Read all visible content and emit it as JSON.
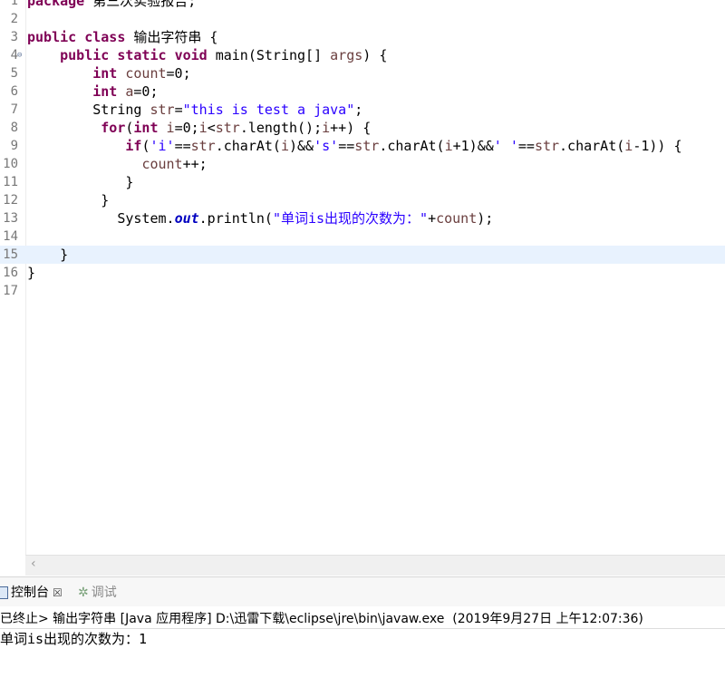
{
  "editor": {
    "lines": [
      {
        "n": "1",
        "segs": [
          {
            "t": "package",
            "c": "kw"
          },
          {
            "t": " 第三次实验报告;",
            "c": ""
          }
        ]
      },
      {
        "n": "2",
        "segs": []
      },
      {
        "n": "3",
        "segs": [
          {
            "t": "public",
            "c": "kw"
          },
          {
            "t": " ",
            "c": ""
          },
          {
            "t": "class",
            "c": "kw"
          },
          {
            "t": " 输出字符串 {",
            "c": ""
          }
        ]
      },
      {
        "n": "4",
        "fold": true,
        "segs": [
          {
            "t": "    ",
            "c": ""
          },
          {
            "t": "public",
            "c": "kw"
          },
          {
            "t": " ",
            "c": ""
          },
          {
            "t": "static",
            "c": "kw"
          },
          {
            "t": " ",
            "c": ""
          },
          {
            "t": "void",
            "c": "kw"
          },
          {
            "t": " main(String[] ",
            "c": ""
          },
          {
            "t": "args",
            "c": "var"
          },
          {
            "t": ") {",
            "c": ""
          }
        ]
      },
      {
        "n": "5",
        "segs": [
          {
            "t": "        ",
            "c": ""
          },
          {
            "t": "int",
            "c": "kw"
          },
          {
            "t": " ",
            "c": ""
          },
          {
            "t": "count",
            "c": "var"
          },
          {
            "t": "=0;",
            "c": ""
          }
        ]
      },
      {
        "n": "6",
        "segs": [
          {
            "t": "        ",
            "c": ""
          },
          {
            "t": "int",
            "c": "kw"
          },
          {
            "t": " ",
            "c": ""
          },
          {
            "t": "a",
            "c": "var"
          },
          {
            "t": "=0;",
            "c": ""
          }
        ]
      },
      {
        "n": "7",
        "segs": [
          {
            "t": "        String ",
            "c": ""
          },
          {
            "t": "str",
            "c": "var"
          },
          {
            "t": "=",
            "c": ""
          },
          {
            "t": "\"this is test a java\"",
            "c": "str"
          },
          {
            "t": ";",
            "c": ""
          }
        ]
      },
      {
        "n": "8",
        "segs": [
          {
            "t": "         ",
            "c": ""
          },
          {
            "t": "for",
            "c": "kw"
          },
          {
            "t": "(",
            "c": ""
          },
          {
            "t": "int",
            "c": "kw"
          },
          {
            "t": " ",
            "c": ""
          },
          {
            "t": "i",
            "c": "var"
          },
          {
            "t": "=0;",
            "c": ""
          },
          {
            "t": "i",
            "c": "var"
          },
          {
            "t": "<",
            "c": ""
          },
          {
            "t": "str",
            "c": "var"
          },
          {
            "t": ".length();",
            "c": ""
          },
          {
            "t": "i",
            "c": "var"
          },
          {
            "t": "++) {",
            "c": ""
          }
        ]
      },
      {
        "n": "9",
        "segs": [
          {
            "t": "            ",
            "c": ""
          },
          {
            "t": "if",
            "c": "kw"
          },
          {
            "t": "(",
            "c": ""
          },
          {
            "t": "'i'",
            "c": "str"
          },
          {
            "t": "==",
            "c": ""
          },
          {
            "t": "str",
            "c": "var"
          },
          {
            "t": ".charAt(",
            "c": ""
          },
          {
            "t": "i",
            "c": "var"
          },
          {
            "t": ")&&",
            "c": ""
          },
          {
            "t": "'s'",
            "c": "str"
          },
          {
            "t": "==",
            "c": ""
          },
          {
            "t": "str",
            "c": "var"
          },
          {
            "t": ".charAt(",
            "c": ""
          },
          {
            "t": "i",
            "c": "var"
          },
          {
            "t": "+1)&&",
            "c": ""
          },
          {
            "t": "' '",
            "c": "str"
          },
          {
            "t": "==",
            "c": ""
          },
          {
            "t": "str",
            "c": "var"
          },
          {
            "t": ".charAt(",
            "c": ""
          },
          {
            "t": "i",
            "c": "var"
          },
          {
            "t": "-1)) {",
            "c": ""
          }
        ]
      },
      {
        "n": "10",
        "segs": [
          {
            "t": "              ",
            "c": ""
          },
          {
            "t": "count",
            "c": "var"
          },
          {
            "t": "++;",
            "c": ""
          }
        ]
      },
      {
        "n": "11",
        "segs": [
          {
            "t": "            }",
            "c": ""
          }
        ]
      },
      {
        "n": "12",
        "segs": [
          {
            "t": "         }",
            "c": ""
          }
        ]
      },
      {
        "n": "13",
        "segs": [
          {
            "t": "           System.",
            "c": ""
          },
          {
            "t": "out",
            "c": "fld"
          },
          {
            "t": ".println(",
            "c": ""
          },
          {
            "t": "\"单词is出现的次数为：\"",
            "c": "str"
          },
          {
            "t": "+",
            "c": ""
          },
          {
            "t": "count",
            "c": "var"
          },
          {
            "t": ");",
            "c": ""
          }
        ]
      },
      {
        "n": "14",
        "segs": []
      },
      {
        "n": "15",
        "current": true,
        "segs": [
          {
            "t": "    }",
            "c": ""
          }
        ]
      },
      {
        "n": "16",
        "segs": [
          {
            "t": "}",
            "c": ""
          }
        ]
      },
      {
        "n": "17",
        "segs": []
      }
    ]
  },
  "console": {
    "tabs": {
      "console_label": "控制台",
      "console_close": "☒",
      "debug_label": "调试",
      "debug_icon": "bug-icon"
    },
    "status": "已终止> 输出字符串 [Java 应用程序] D:\\迅雷下载\\eclipse\\jre\\bin\\javaw.exe  (2019年9月27日 上午12:07:36)",
    "output": "单词is出现的次数为：1"
  },
  "colors": {
    "keyword": "#7f0055",
    "string": "#2a00ff",
    "variable": "#6a3e3e",
    "static_field": "#0000c0",
    "current_line": "#e8f2fe"
  }
}
